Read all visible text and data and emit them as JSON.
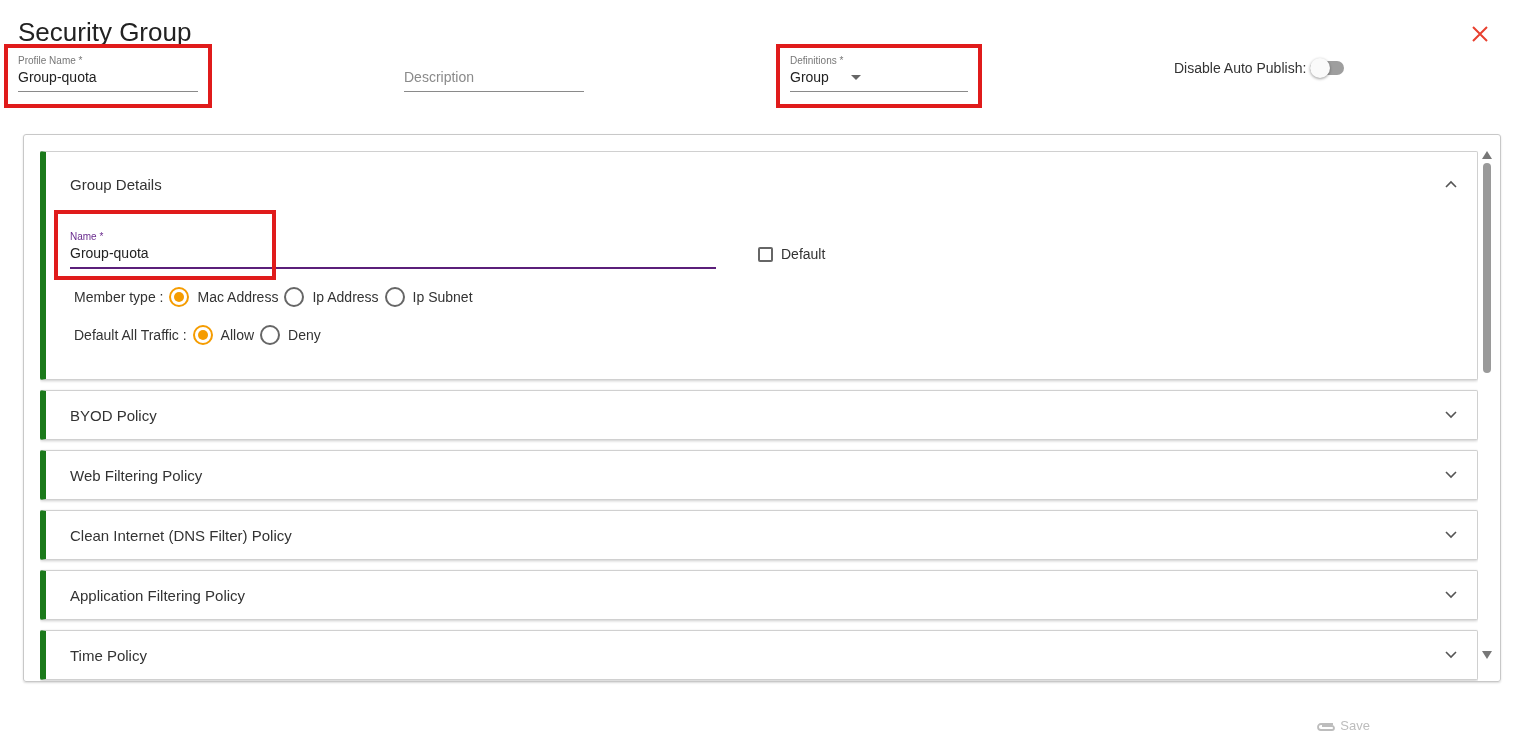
{
  "title": "Security Group",
  "header_fields": [
    {
      "kind": "text",
      "label": "Profile Name *",
      "value": "Group-quota",
      "highlighted": true
    },
    {
      "kind": "text",
      "placeholder": "Description",
      "highlighted": false
    },
    {
      "kind": "select",
      "label": "Definitions *",
      "value": "Group",
      "highlighted": true
    }
  ],
  "auto_publish": {
    "label": "Disable Auto Publish:",
    "on": false
  },
  "sections": [
    {
      "title": "Group Details",
      "expanded": true
    },
    {
      "title": "BYOD Policy",
      "expanded": false
    },
    {
      "title": "Web Filtering Policy",
      "expanded": false
    },
    {
      "title": "Clean Internet (DNS Filter) Policy",
      "expanded": false
    },
    {
      "title": "Application Filtering Policy",
      "expanded": false
    },
    {
      "title": "Time Policy",
      "expanded": false
    }
  ],
  "group_details": {
    "name_field": {
      "label": "Name *",
      "value": "Group-quota",
      "highlighted": true
    },
    "default_checkbox": {
      "label": "Default",
      "checked": false
    },
    "radio_groups": [
      {
        "label": "Member type :",
        "options": [
          {
            "label": "Mac Address",
            "selected": true
          },
          {
            "label": "Ip Address",
            "selected": false
          },
          {
            "label": "Ip Subnet",
            "selected": false
          }
        ]
      },
      {
        "label": "Default All Traffic :",
        "options": [
          {
            "label": "Allow",
            "selected": true
          },
          {
            "label": "Deny",
            "selected": false
          }
        ]
      }
    ]
  },
  "save": {
    "label": "Save",
    "disabled": true
  }
}
